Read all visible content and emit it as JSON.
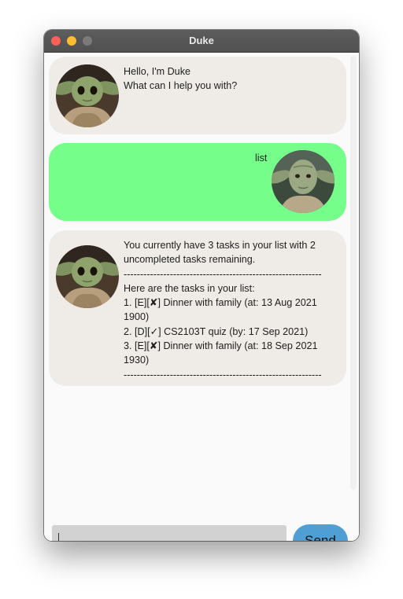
{
  "window": {
    "title": "Duke"
  },
  "messages": [
    {
      "sender": "duke",
      "avatar": "baby-yoda",
      "text": "Hello, I'm Duke\nWhat can I help you with?"
    },
    {
      "sender": "user",
      "avatar": "yoda",
      "text": "list"
    },
    {
      "sender": "duke",
      "avatar": "baby-yoda",
      "text": "You currently have 3 tasks in your list with 2\nuncompleted tasks remaining.\n------------------------------------------------------------\nHere are the tasks in your list:\n1. [E][✘] Dinner with family (at: 13 Aug 2021\n1900)\n2. [D][✓] CS2103T quiz (by: 17 Sep 2021)\n3. [E][✘] Dinner with family (at: 18 Sep 2021\n1930)\n------------------------------------------------------------"
    }
  ],
  "input": {
    "value": ""
  },
  "send_button": {
    "label": "Send"
  },
  "colors": {
    "duke_bubble": "#efebe6",
    "user_bubble": "#76fe8a",
    "send_button": "#4f9fd4",
    "input_background": "#d2d2d2"
  }
}
